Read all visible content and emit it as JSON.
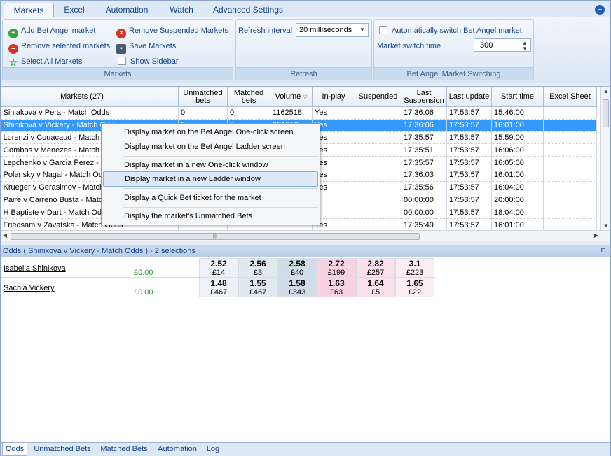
{
  "ribbon_tabs": [
    "Markets",
    "Excel",
    "Automation",
    "Watch",
    "Advanced Settings"
  ],
  "markets_group": {
    "add": "Add Bet Angel market",
    "remove_suspended": "Remove Suspended Markets",
    "remove_selected": "Remove selected markets",
    "save": "Save Markets",
    "select_all": "Select All Markets",
    "show_sidebar": "Show Sidebar",
    "label": "Markets"
  },
  "refresh_group": {
    "interval_label": "Refresh interval",
    "interval_value": "20 milliseconds",
    "label": "Refresh"
  },
  "switching_group": {
    "auto_switch": "Automatically switch Bet Angel market",
    "switch_time_label": "Market switch time",
    "switch_time_value": "300",
    "label": "Bet Angel Market Switching"
  },
  "grid": {
    "headers": [
      "Markets (27)",
      "",
      "Unmatched bets",
      "Matched bets",
      "Volume",
      "In-play",
      "Suspended",
      "Last Suspension",
      "Last update",
      "Start time",
      "Excel Sheet"
    ],
    "rows": [
      [
        "Siniakova v Pera - Match Odds",
        "",
        "0",
        "0",
        "1162518",
        "Yes",
        "",
        "17:36:06",
        "17:53:57",
        "15:46:00",
        ""
      ],
      [
        "Shinikova v Vickery - Match Odds",
        "",
        "0",
        "0",
        "381818",
        "Yes",
        "",
        "17:36:06",
        "17:53:57",
        "16:01:00",
        ""
      ],
      [
        "Lorenzi v Couacaud - Match Odds",
        "",
        "",
        "",
        "",
        "Yes",
        "",
        "17:35:57",
        "17:53:57",
        "15:59:00",
        ""
      ],
      [
        "Gombos v Menezes - Match Odds",
        "",
        "",
        "",
        "",
        "Yes",
        "",
        "17:35:51",
        "17:53:57",
        "16:06:00",
        ""
      ],
      [
        "Lepchenko v Garcia Perez - Match Odds",
        "",
        "",
        "",
        "",
        "Yes",
        "",
        "17:35:57",
        "17:53:57",
        "16:05:00",
        ""
      ],
      [
        "Polansky v Nagal - Match Odds",
        "",
        "",
        "",
        "",
        "Yes",
        "",
        "17:36:03",
        "17:53:57",
        "16:01:00",
        ""
      ],
      [
        "Krueger v Gerasimov - Match Odds",
        "",
        "",
        "",
        "",
        "Yes",
        "",
        "17:35:56",
        "17:53:57",
        "16:04:00",
        ""
      ],
      [
        "Paire v Carreno Busta - Match Odds",
        "",
        "",
        "",
        "",
        "",
        "",
        "00:00:00",
        "17:53:57",
        "20:00:00",
        ""
      ],
      [
        "H Baptiste v Dart - Match Odds",
        "",
        "",
        "",
        "",
        "",
        "",
        "00:00:00",
        "17:53:57",
        "18:04:00",
        ""
      ],
      [
        "Friedsam v Zavatska - Match Odds",
        "",
        "",
        "",
        "",
        "Yes",
        "",
        "17:35:49",
        "17:53:57",
        "16:01:00",
        ""
      ]
    ]
  },
  "context_menu": [
    "Display market on the Bet Angel One-click screen",
    "Display market on the Bet Angel Ladder screen",
    "Display market in a new One-click window",
    "Display market in a new Ladder window",
    "Display a Quick Bet ticket for the market",
    "Display the market's Unmatched Bets"
  ],
  "odds": {
    "title": "Odds ( Shinikova v Vickery - Match Odds ) - 2 selections",
    "runners": [
      {
        "name": "Isabella Shinikova",
        "pl": "£0.00",
        "prices": [
          [
            "2.52",
            "£14"
          ],
          [
            "2.56",
            "£3"
          ],
          [
            "2.58",
            "£40"
          ],
          [
            "2.72",
            "£199"
          ],
          [
            "2.82",
            "£257"
          ],
          [
            "3.1",
            "£223"
          ]
        ]
      },
      {
        "name": "Sachia Vickery",
        "pl": "£0.00",
        "prices": [
          [
            "1.48",
            "£467"
          ],
          [
            "1.55",
            "£467"
          ],
          [
            "1.58",
            "£343"
          ],
          [
            "1.63",
            "£63"
          ],
          [
            "1.64",
            "£5"
          ],
          [
            "1.65",
            "£22"
          ]
        ]
      }
    ]
  },
  "bottom_tabs": [
    "Odds",
    "Unmatched Bets",
    "Matched Bets",
    "Automation",
    "Log"
  ]
}
